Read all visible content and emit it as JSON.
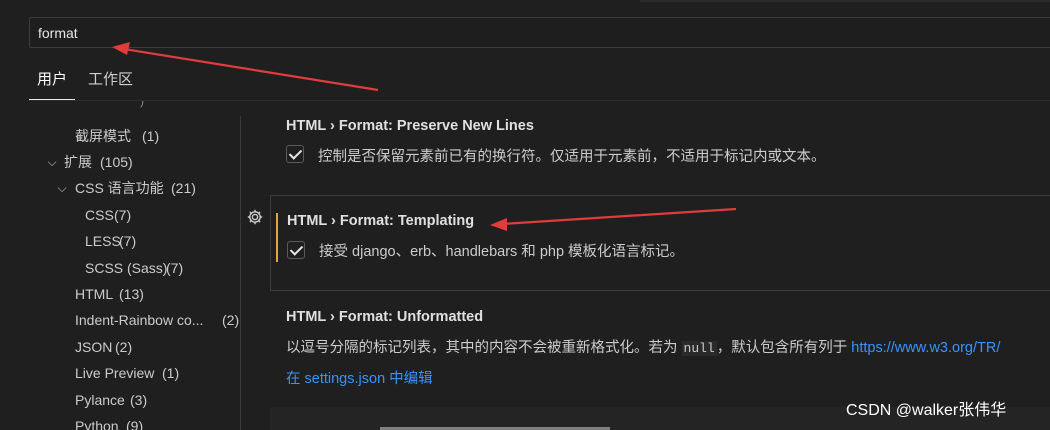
{
  "search": {
    "value": "format"
  },
  "tabs": [
    {
      "label": "用户",
      "active": true
    },
    {
      "label": "工作区",
      "active": false
    }
  ],
  "tree": [
    {
      "label": "截屏模式",
      "count": "(1)",
      "expanded": null
    },
    {
      "label": "扩展",
      "count": "(105)",
      "expanded": true
    },
    {
      "label": "CSS 语言功能",
      "count": "(21)",
      "expanded": true
    },
    {
      "label": "CSS",
      "count": "(7)",
      "expanded": null
    },
    {
      "label": "LESS",
      "count": "(7)",
      "expanded": null
    },
    {
      "label": "SCSS (Sass)",
      "count": "(7)",
      "expanded": null
    },
    {
      "label": "HTML",
      "count": "(13)",
      "expanded": null
    },
    {
      "label": "Indent-Rainbow co...",
      "count": "(2)",
      "expanded": null
    },
    {
      "label": "JSON",
      "count": "(2)",
      "expanded": null
    },
    {
      "label": "Live Preview",
      "count": "(1)",
      "expanded": null
    },
    {
      "label": "Pylance",
      "count": "(3)",
      "expanded": null
    },
    {
      "label": "Python",
      "count": "(9)",
      "expanded": null
    }
  ],
  "settings": {
    "preserve": {
      "title": "HTML › Format: Preserve New Lines",
      "desc": "控制是否保留元素前已有的换行符。仅适用于元素前，不适用于标记内或文本。",
      "checked": true
    },
    "templating": {
      "title": "HTML › Format: Templating",
      "desc": "接受 django、erb、handlebars 和 php 模板化语言标记。",
      "checked": true
    },
    "unformatted": {
      "title": "HTML › Format: Unformatted",
      "desc_pre": "以逗号分隔的标记列表，其中的内容不会被重新格式化。若为 ",
      "desc_code": "null",
      "desc_post": "，默认包含所有列于 ",
      "desc_link": "https://www.w3.org/TR/",
      "edit_link": "在 settings.json 中编辑"
    }
  },
  "watermark": "CSDN @walker张伟华",
  "colors": {
    "accent": "#3794ff",
    "modified": "#e8a33d",
    "annotation": "#e03c3c"
  }
}
